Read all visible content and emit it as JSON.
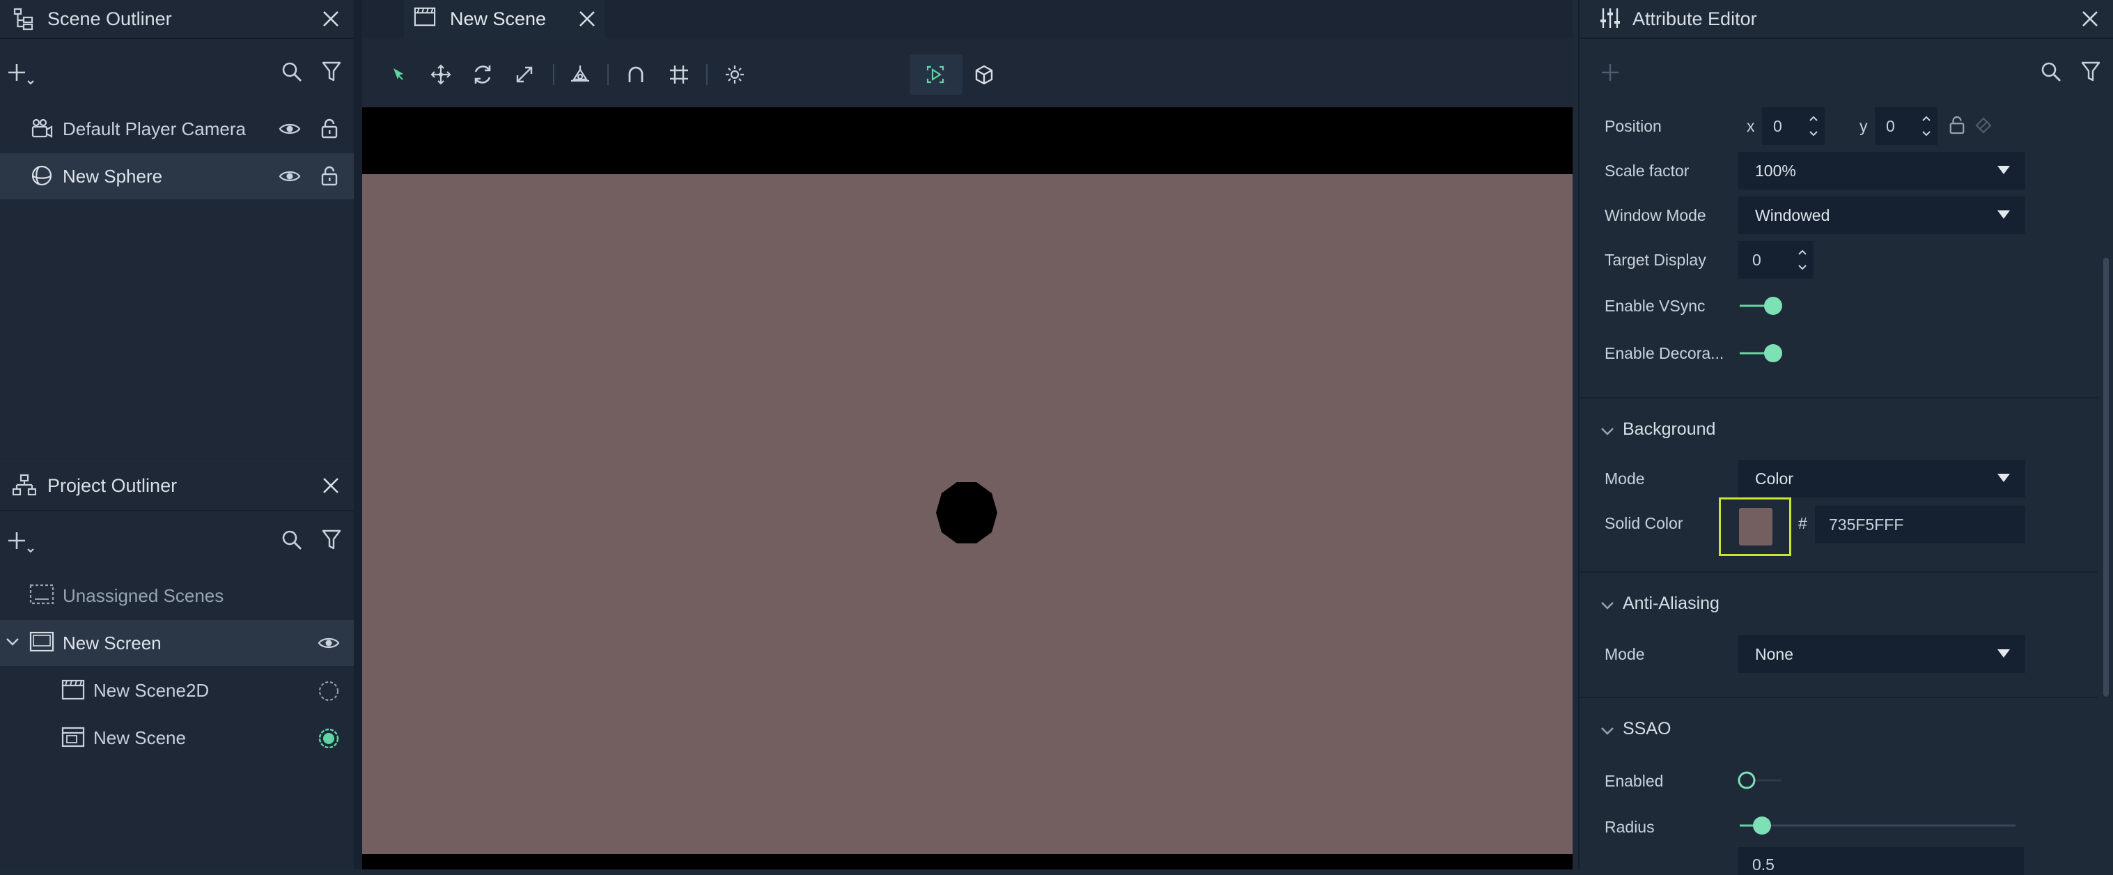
{
  "scene_outliner": {
    "title": "Scene Outliner",
    "items": [
      {
        "label": "Default Player Camera"
      },
      {
        "label": "New Sphere"
      }
    ]
  },
  "project_outliner": {
    "title": "Project Outliner",
    "items": [
      {
        "label": "Unassigned Scenes"
      },
      {
        "label": "New Screen"
      },
      {
        "label": "New Scene2D"
      },
      {
        "label": "New Scene"
      }
    ]
  },
  "center": {
    "tab_label": "New Scene",
    "background_color": "#735F5F",
    "sphere_color": "#000000"
  },
  "attribute_editor": {
    "title": "Attribute Editor",
    "position": {
      "label": "Position",
      "x_label": "x",
      "x_value": "0",
      "y_label": "y",
      "y_value": "0"
    },
    "scale_factor": {
      "label": "Scale factor",
      "value": "100%"
    },
    "window_mode": {
      "label": "Window Mode",
      "value": "Windowed"
    },
    "target_display": {
      "label": "Target Display",
      "value": "0"
    },
    "enable_vsync": {
      "label": "Enable VSync",
      "on": true
    },
    "enable_decorations": {
      "label": "Enable Decora...",
      "on": true
    },
    "background": {
      "title": "Background",
      "mode_label": "Mode",
      "mode_value": "Color",
      "solid_color_label": "Solid Color",
      "hash": "#",
      "solid_color_value": "735F5FFF",
      "swatch_color": "#735F5F"
    },
    "anti_aliasing": {
      "title": "Anti-Aliasing",
      "mode_label": "Mode",
      "mode_value": "None"
    },
    "ssao": {
      "title": "SSAO",
      "enabled_label": "Enabled",
      "enabled": false,
      "radius_label": "Radius",
      "radius_value": "0.5"
    }
  },
  "colors": {
    "accent": "#5fd6a4",
    "highlight_border": "#c8e532"
  }
}
